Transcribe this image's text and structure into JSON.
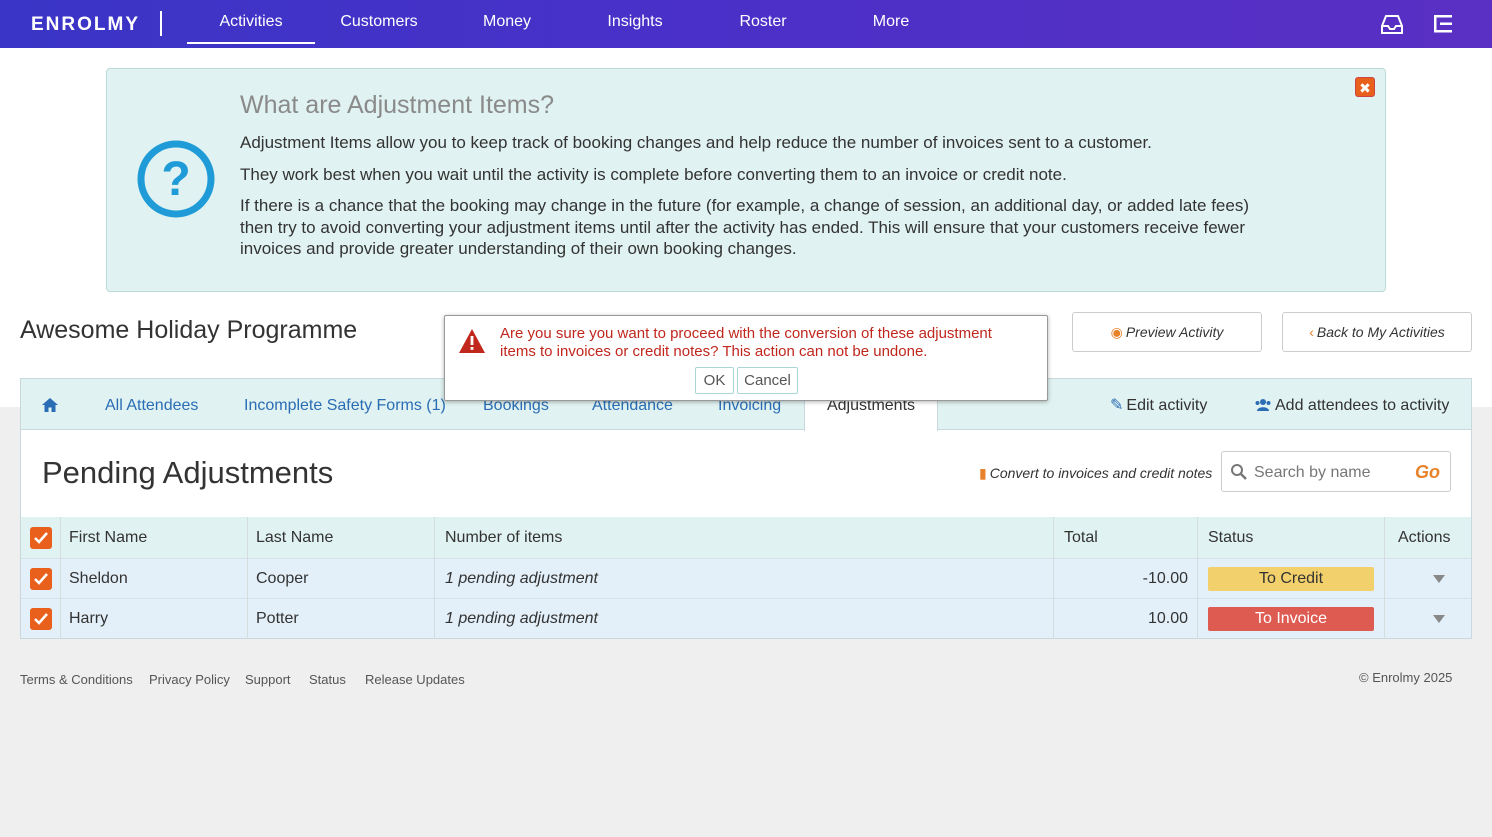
{
  "nav": {
    "logo": "ENROLMY",
    "items": [
      "Activities",
      "Customers",
      "Money",
      "Insights",
      "Roster",
      "More"
    ],
    "active": "Activities"
  },
  "info": {
    "title": "What are Adjustment Items?",
    "p1": "Adjustment Items allow you to keep track of booking changes and help reduce the number of invoices sent to a customer.",
    "p2": "They work best when you wait until the activity is complete before converting them to an invoice or credit note.",
    "p3": "If there is a chance that the booking may change in the future (for example, a change of session, an additional day, or added late fees) then try to avoid converting your adjustment items until after the activity has ended. This will ensure that your customers receive fewer invoices and provide greater understanding of their own booking changes.",
    "close_glyph": "✖"
  },
  "activity": {
    "title": "Awesome Holiday Programme",
    "preview_label": "Preview Activity",
    "back_label": "Back to My Activities"
  },
  "tabs": {
    "items": [
      "All Attendees",
      "Incomplete Safety Forms (1)",
      "Bookings",
      "Attendance",
      "Invoicing",
      "Adjustments"
    ],
    "active": "Adjustments",
    "edit_label": "Edit activity",
    "add_label": "Add attendees to activity"
  },
  "pending": {
    "title": "Pending Adjustments",
    "convert_label": "Convert to invoices and credit notes",
    "search_placeholder": "Search by name",
    "go_label": "Go"
  },
  "table": {
    "headers": [
      "First Name",
      "Last Name",
      "Number of items",
      "Total",
      "Status",
      "Actions"
    ],
    "rows": [
      {
        "first": "Sheldon",
        "last": "Cooper",
        "items": "1 pending adjustment",
        "total": "-10.00",
        "status": "To Credit"
      },
      {
        "first": "Harry",
        "last": "Potter",
        "items": "1 pending adjustment",
        "total": "10.00",
        "status": "To Invoice"
      }
    ]
  },
  "footer": {
    "links": [
      "Terms & Conditions",
      "Privacy Policy",
      "Support",
      "Status",
      "Release Updates"
    ],
    "copyright": "© Enrolmy 2025"
  },
  "dialog": {
    "message": "Are you sure you want to proceed with the conversion of these adjustment items to invoices or credit notes? This action can not be undone.",
    "ok_label": "OK",
    "cancel_label": "Cancel"
  },
  "colors": {
    "accent": "#e8822a",
    "link": "#2a6db5",
    "nav_bg": "#4b30c8",
    "error": "#c0271d"
  }
}
